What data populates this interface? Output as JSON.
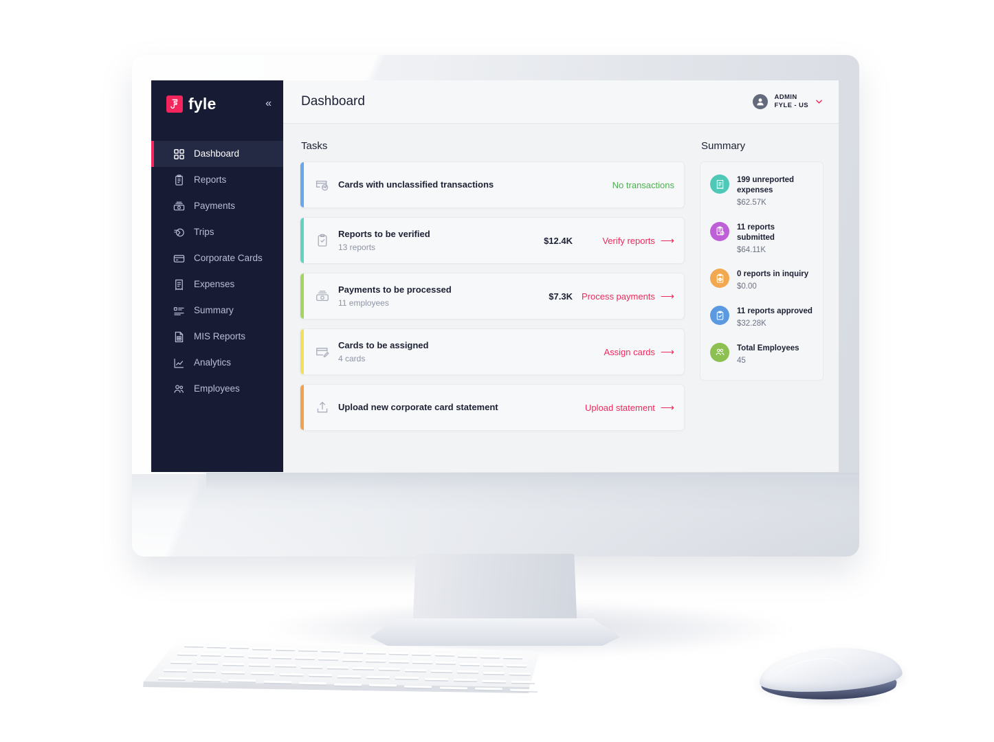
{
  "brand": {
    "logo_text": "fyle",
    "logo_mark": "fyle-logo-icon",
    "accent_color": "#f2265c",
    "sidebar_color": "#171b34"
  },
  "sidebar": {
    "collapse_label": "«",
    "items": [
      {
        "label": "Dashboard",
        "icon": "grid-icon",
        "active": true
      },
      {
        "label": "Reports",
        "icon": "clipboard-icon",
        "active": false
      },
      {
        "label": "Payments",
        "icon": "banknote-icon",
        "active": false
      },
      {
        "label": "Trips",
        "icon": "trips-icon",
        "active": false
      },
      {
        "label": "Corporate Cards",
        "icon": "card-icon",
        "active": false
      },
      {
        "label": "Expenses",
        "icon": "receipt-icon",
        "active": false
      },
      {
        "label": "Summary",
        "icon": "list-icon",
        "active": false
      },
      {
        "label": "MIS Reports",
        "icon": "document-grid-icon",
        "active": false
      },
      {
        "label": "Analytics",
        "icon": "chart-line-icon",
        "active": false
      },
      {
        "label": "Employees",
        "icon": "people-icon",
        "active": false
      }
    ]
  },
  "topbar": {
    "title": "Dashboard",
    "avatar_icon": "user-avatar-icon",
    "role": "ADMIN",
    "org": "FYLE - US",
    "caret": "⌄"
  },
  "tasks": {
    "heading": "Tasks",
    "items": [
      {
        "title": "Cards with unclassified transactions",
        "subtitle": "",
        "amount": "",
        "action": "No transactions",
        "action_type": "status",
        "has_arrow": false,
        "icon": "card-clock-icon",
        "accent": "#6aa6ea"
      },
      {
        "title": "Reports to be verified",
        "subtitle": "13 reports",
        "amount": "$12.4K",
        "action": "Verify reports",
        "action_type": "link",
        "has_arrow": true,
        "icon": "clipboard-check-icon",
        "accent": "#63d3c0"
      },
      {
        "title": "Payments to be processed",
        "subtitle": "11 employees",
        "amount": "$7.3K",
        "action": "Process payments",
        "action_type": "link",
        "has_arrow": true,
        "icon": "banknote-icon",
        "accent": "#a5d55e"
      },
      {
        "title": "Cards to be assigned",
        "subtitle": "4 cards",
        "amount": "",
        "action": "Assign cards",
        "action_type": "link",
        "has_arrow": true,
        "icon": "card-edit-icon",
        "accent": "#f2de5f"
      },
      {
        "title": "Upload new corporate card statement",
        "subtitle": "",
        "amount": "",
        "action": "Upload statement",
        "action_type": "link",
        "has_arrow": true,
        "icon": "upload-icon",
        "accent": "#f2a24f"
      }
    ],
    "arrow_glyph": "⟶"
  },
  "summary": {
    "heading": "Summary",
    "items": [
      {
        "label": "199 unreported expenses",
        "value": "$62.57K",
        "icon": "receipt-icon",
        "color": "#4ec9b8"
      },
      {
        "label": "11 reports submitted",
        "value": "$64.11K",
        "icon": "clipboard-send-icon",
        "color": "#bf5fd8"
      },
      {
        "label": "0 reports in inquiry",
        "value": "$0.00",
        "icon": "clipboard-eye-icon",
        "color": "#f2a84f"
      },
      {
        "label": "11 reports approved",
        "value": "$32.28K",
        "icon": "clipboard-check-icon",
        "color": "#5b9ae0"
      },
      {
        "label": "Total Employees",
        "value": "45",
        "icon": "people-icon",
        "color": "#8cc152"
      }
    ]
  },
  "peripherals": {
    "keyboard": "magic-keyboard",
    "mouse": "magic-mouse"
  }
}
